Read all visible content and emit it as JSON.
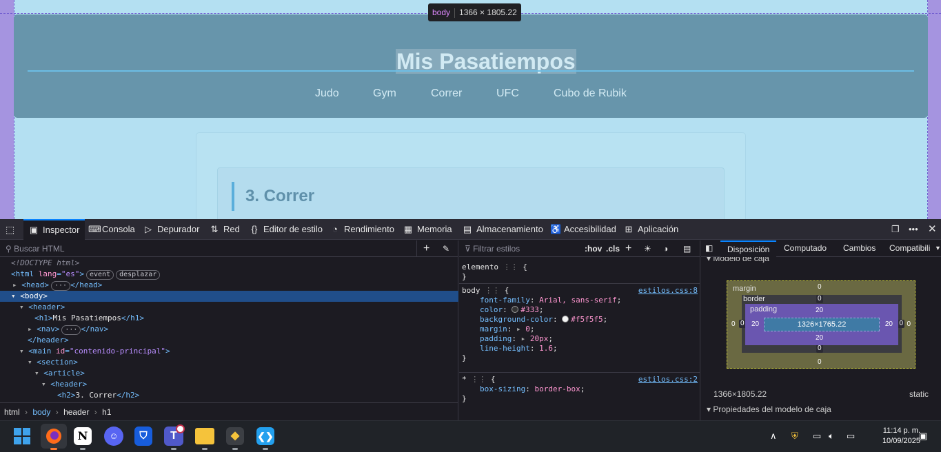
{
  "page": {
    "tooltip": {
      "tag": "body",
      "size": "1366 × 1805.22"
    },
    "title": "Mis Pasatiempos",
    "nav": [
      "Judo",
      "Gym",
      "Correr",
      "UFC",
      "Cubo de Rubik"
    ],
    "article_title": "3. Correr"
  },
  "devtools": {
    "tabs": [
      {
        "name": "Inspector",
        "icon": "inspector-icon"
      },
      {
        "name": "Consola",
        "icon": "console-icon"
      },
      {
        "name": "Depurador",
        "icon": "debugger-icon"
      },
      {
        "name": "Red",
        "icon": "network-icon"
      },
      {
        "name": "Editor de estilo",
        "icon": "style-editor-icon"
      },
      {
        "name": "Rendimiento",
        "icon": "performance-icon"
      },
      {
        "name": "Memoria",
        "icon": "memory-icon"
      },
      {
        "name": "Almacenamiento",
        "icon": "storage-icon"
      },
      {
        "name": "Accesibilidad",
        "icon": "accessibility-icon"
      },
      {
        "name": "Aplicación",
        "icon": "application-icon"
      }
    ],
    "search_placeholder": "Buscar HTML",
    "tree": {
      "doctype": "<!DOCTYPE html>",
      "pill_event": "event",
      "pill_scroll": "desplazar",
      "lang_value": "\"es\"",
      "main_id": "\"contenido-principal\"",
      "h1_text": "Mis Pasatiempos",
      "h2_text": "3. Correr"
    },
    "breadcrumbs": [
      "html",
      "body",
      "header",
      "h1"
    ],
    "styles": {
      "filter_placeholder": "Filtrar estilos",
      "hov": ":hov",
      "cls": ".cls",
      "element_selector": "elemento",
      "body_selector": "body",
      "body_source": "estilos.css:8",
      "body_decls": [
        {
          "prop": "font-family",
          "value": "Arial, sans-serif"
        },
        {
          "prop": "color",
          "value": "#333"
        },
        {
          "prop": "background-color",
          "value": "#f5f5f5"
        },
        {
          "prop": "margin",
          "value": "0"
        },
        {
          "prop": "padding",
          "value": "20px"
        },
        {
          "prop": "line-height",
          "value": "1.6"
        }
      ],
      "star_selector": "*",
      "star_source": "estilos.css:2",
      "star_decls": [
        {
          "prop": "box-sizing",
          "value": "border-box"
        }
      ]
    },
    "layout": {
      "tabs": [
        "Disposición",
        "Computado",
        "Cambios",
        "Compatibili"
      ],
      "section_partial": "Modelo de caja",
      "margin_label": "margin",
      "border_label": "border",
      "padding_label": "padding",
      "margin_top": "0",
      "margin_right": "0",
      "margin_bottom": "0",
      "margin_left": "0",
      "border_top": "0",
      "border_right": "0",
      "border_bottom": "0",
      "border_left": "0",
      "padding_top": "20",
      "padding_right": "20",
      "padding_bottom": "20",
      "padding_left": "20",
      "content_size": "1326×1765.22",
      "element_size": "1366×1805.22",
      "position": "static",
      "box_props": "Propiedades del modelo de caja"
    }
  },
  "taskbar": {
    "time": "11:14 p. m.",
    "date": "10/09/2025",
    "apps": [
      "start",
      "firefox",
      "notion",
      "discord",
      "bitwarden",
      "teams",
      "file-explorer",
      "git",
      "vscode"
    ]
  }
}
